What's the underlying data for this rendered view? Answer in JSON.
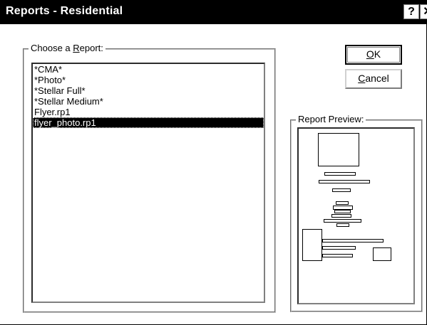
{
  "window": {
    "title": "Reports - Residential",
    "help_label": "?",
    "close_label": "✕"
  },
  "choose_group": {
    "label_prefix": "Choose a ",
    "label_accel": "R",
    "label_suffix": "eport:",
    "items": [
      {
        "label": "*CMA*"
      },
      {
        "label": "*Photo*"
      },
      {
        "label": "*Stellar Full*"
      },
      {
        "label": "*Stellar Medium*"
      },
      {
        "label": "Flyer.rp1"
      },
      {
        "label": "flyer_photo.rp1"
      }
    ],
    "selected_index": 5
  },
  "buttons": {
    "ok_accel": "O",
    "ok_rest": "K",
    "cancel_accel": "C",
    "cancel_rest": "ancel"
  },
  "preview_group": {
    "label": "Report Preview:"
  }
}
